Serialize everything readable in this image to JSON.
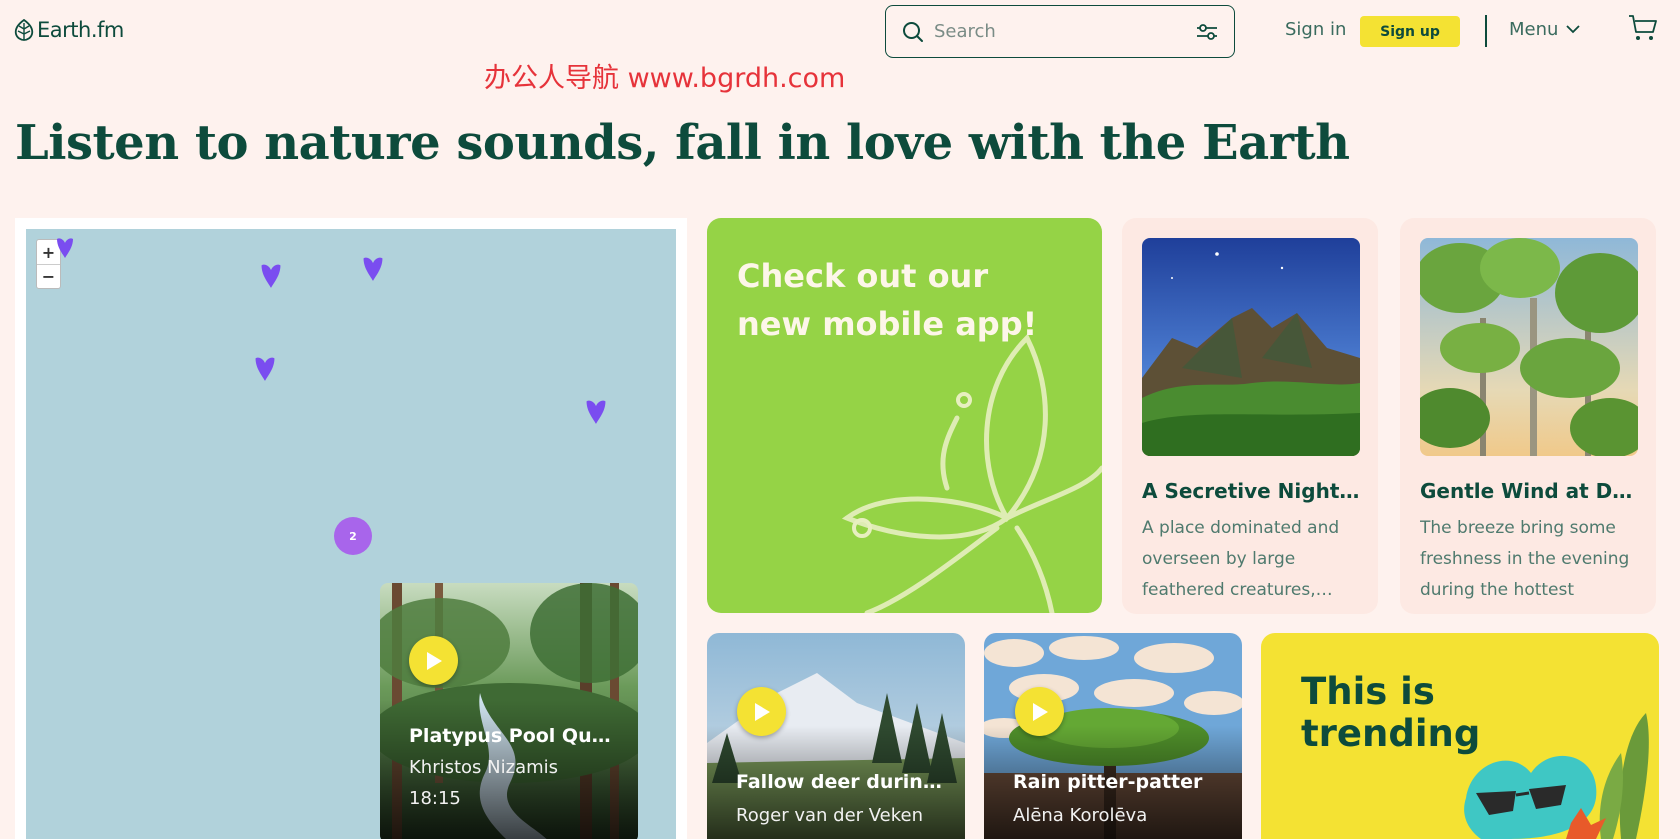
{
  "header": {
    "brand": "Earth.fm",
    "search_placeholder": "Search",
    "signin_label": "Sign in",
    "signup_label": "Sign up",
    "menu_label": "Menu"
  },
  "watermark": "办公人导航 www.bgrdh.com",
  "headline": "Listen to nature sounds, fall in love with the Earth",
  "map": {
    "zoom_in": "+",
    "zoom_out": "−",
    "cluster_count": "2",
    "card": {
      "title": "Platypus Pool Quie…",
      "author": "Khristos Nizamis",
      "duration": "18:15"
    }
  },
  "promo": {
    "text": "Check out our new mobile app!"
  },
  "stories": [
    {
      "title": "A Secretive Night in a…",
      "description": "A place dominated and overseen by large feathered creatures,…"
    },
    {
      "title": "Gentle Wind at Dusk i…",
      "description": "The breeze bring some freshness in the evening during the hottest mont…"
    }
  ],
  "tracks": [
    {
      "title": "Fallow deer during …",
      "author": "Roger van der Veken"
    },
    {
      "title": "Rain pitter-patter",
      "author": "Alēna Korolēva"
    }
  ],
  "trending": {
    "text_line1": "This is",
    "text_line2": "trending"
  },
  "colors": {
    "brand_dark_green": "#0d4b3c",
    "accent_yellow": "#f4e233",
    "promo_green": "#95d346",
    "pin_purple": "#7a4df0",
    "map_water": "#b1d2db",
    "background": "#fef2ee"
  },
  "icons": [
    "leaf-logo-icon",
    "search-icon",
    "filter-icon",
    "chevron-down-icon",
    "cart-icon",
    "map-pin-icon",
    "play-icon"
  ]
}
